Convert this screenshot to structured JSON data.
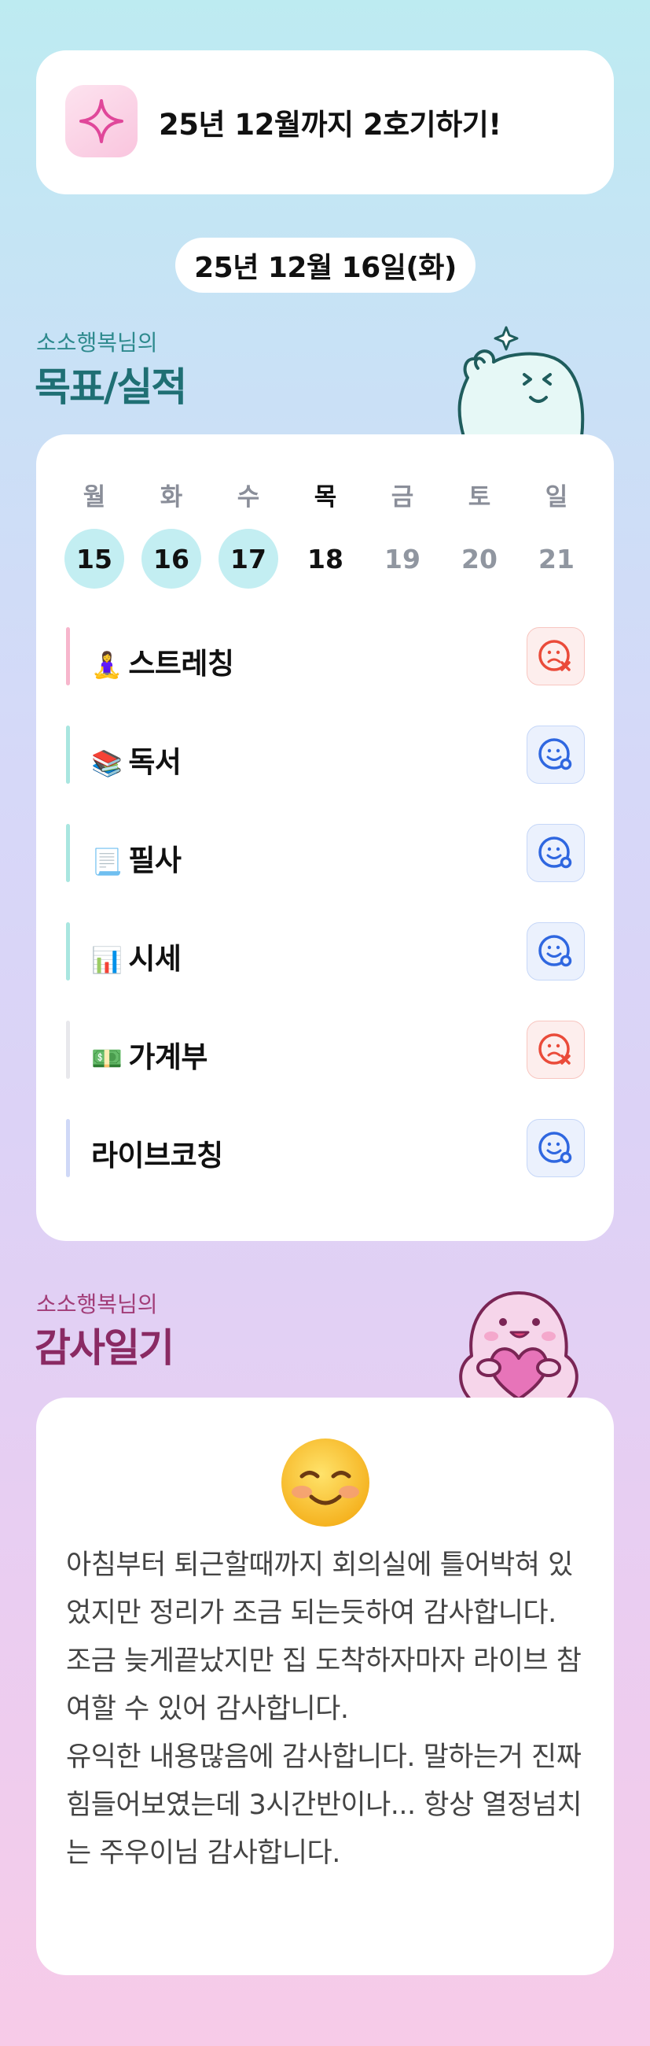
{
  "goal": {
    "icon": "sparkle-icon",
    "text": "25년 12월까지 2호기하기!"
  },
  "date": "25년 12월 16일(화)",
  "goals_section": {
    "subtitle": "소소행복님의",
    "title": "목표/실적"
  },
  "week": {
    "days": [
      {
        "label": "월",
        "num": "15",
        "state": "done"
      },
      {
        "label": "화",
        "num": "16",
        "state": "done"
      },
      {
        "label": "수",
        "num": "17",
        "state": "done"
      },
      {
        "label": "목",
        "num": "18",
        "state": "today"
      },
      {
        "label": "금",
        "num": "19",
        "state": "future"
      },
      {
        "label": "토",
        "num": "20",
        "state": "future"
      },
      {
        "label": "일",
        "num": "21",
        "state": "future"
      }
    ]
  },
  "habits": [
    {
      "emoji": "🧘‍♀️",
      "name": "스트레칭",
      "status": "fail",
      "bar_color": "#f7b6cc"
    },
    {
      "emoji": "📚",
      "name": "독서",
      "status": "ok",
      "bar_color": "#a9e6e0"
    },
    {
      "emoji": "📃",
      "name": "필사",
      "status": "ok",
      "bar_color": "#a9e6e0"
    },
    {
      "emoji": "📊",
      "name": "시세",
      "status": "ok",
      "bar_color": "#a9e6e0"
    },
    {
      "emoji": "💵",
      "name": "가계부",
      "status": "fail",
      "bar_color": "#e8e8ec"
    },
    {
      "emoji": "",
      "name": "라이브코칭",
      "status": "ok",
      "bar_color": "#cfd8f7"
    }
  ],
  "diary_section": {
    "subtitle": "소소행복님의",
    "title": "감사일기"
  },
  "diary": {
    "mood": "smiling-face-icon",
    "paragraphs": [
      "아침부터 퇴근할때까지 회의실에 틀어박혀 있었지만 정리가 조금 되는듯하여 감사합니다.",
      "조금 늦게끝났지만 집 도착하자마자 라이브 참여할 수 있어 감사합니다.",
      "유익한 내용많음에 감사합니다. 말하는거 진짜 힘들어보였는데 3시간반이나... 항상 열정넘치는 주우이님 감사합니다."
    ]
  },
  "colors": {
    "goals_title": "#1f6f74",
    "goals_subtitle": "#2e8a8e",
    "diary_title": "#8a2a63",
    "diary_subtitle": "#a23d78",
    "done_circle": "#c3eef2"
  }
}
